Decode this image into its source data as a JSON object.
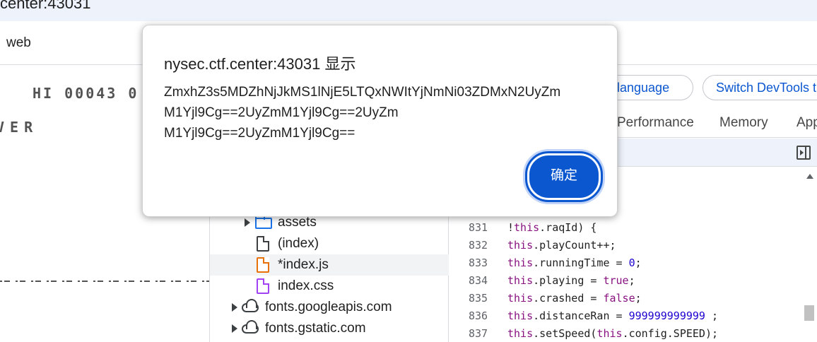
{
  "browser": {
    "url": "center:43031",
    "bookmark": "web"
  },
  "game": {
    "hi_score": "HI 00043 0",
    "game_over": "VER"
  },
  "devtools": {
    "lang_button": "s language",
    "switch_button": "Switch DevTools t",
    "tabs": [
      "Performance",
      "Memory",
      "App"
    ],
    "files": [
      {
        "name": "assets",
        "type": "folder"
      },
      {
        "name": "(index)",
        "type": "file"
      },
      {
        "name": "*index.js",
        "type": "js"
      },
      {
        "name": "index.css",
        "type": "css"
      },
      {
        "name": "fonts.googleapis.com",
        "type": "cloud"
      },
      {
        "name": "fonts.gstatic.com",
        "type": "cloud"
      }
    ],
    "code_lines": [
      {
        "num": "831",
        "text": "!this.raqId) {"
      },
      {
        "num": "832",
        "text": "this.playCount++;"
      },
      {
        "num": "833",
        "text": "this.runningTime = 0;"
      },
      {
        "num": "834",
        "text": "this.playing = true;"
      },
      {
        "num": "835",
        "text": "this.crashed = false;"
      },
      {
        "num": "836",
        "text": "this.distanceRan = 999999999999  ;"
      },
      {
        "num": "837",
        "text": "this.setSpeed(this.config.SPEED);"
      }
    ]
  },
  "dialog": {
    "title": "nysec.ctf.center:43031 显示",
    "message_lines": [
      "ZmxhZ3s5MDZhNjJkMS1lNjE5LTQxNWItYjNmNi03ZDMxN2UyZm",
      "M1Yjl9Cg==2UyZmM1Yjl9Cg==2UyZm",
      "M1Yjl9Cg==2UyZmM1Yjl9Cg=="
    ],
    "ok_label": "确定"
  }
}
